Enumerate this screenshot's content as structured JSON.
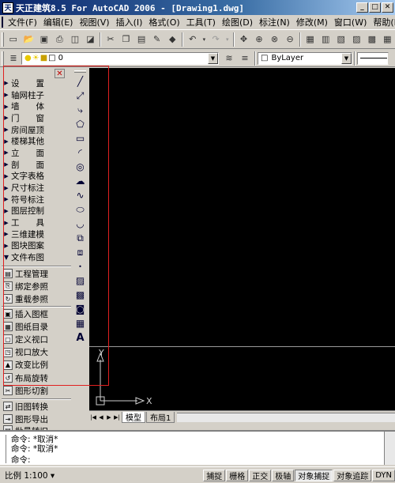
{
  "window": {
    "title": "天正建筑8.5 For AutoCAD 2006 - [Drawing1.dwg]",
    "app_icon_label": "天"
  },
  "menubar": {
    "items": [
      "文件(F)",
      "编辑(E)",
      "视图(V)",
      "插入(I)",
      "格式(O)",
      "工具(T)",
      "绘图(D)",
      "标注(N)",
      "修改(M)",
      "窗口(W)",
      "帮助(H)"
    ]
  },
  "layer_toolbar": {
    "layer_value": "0",
    "color_value": "ByLayer"
  },
  "tangent_menu": {
    "categories": [
      {
        "label": "设　　置",
        "open": false
      },
      {
        "label": "轴网柱子",
        "open": false
      },
      {
        "label": "墙　　体",
        "open": false
      },
      {
        "label": "门　　窗",
        "open": false
      },
      {
        "label": "房间屋顶",
        "open": false
      },
      {
        "label": "楼梯其他",
        "open": false
      },
      {
        "label": "立　　面",
        "open": false
      },
      {
        "label": "剖　　面",
        "open": false
      },
      {
        "label": "文字表格",
        "open": false
      },
      {
        "label": "尺寸标注",
        "open": false
      },
      {
        "label": "符号标注",
        "open": false
      },
      {
        "label": "图层控制",
        "open": false
      },
      {
        "label": "工　　具",
        "open": false
      },
      {
        "label": "三维建模",
        "open": false
      },
      {
        "label": "图块图案",
        "open": false
      },
      {
        "label": "文件布图",
        "open": true
      }
    ],
    "file_layout_items": [
      {
        "label": "工程管理",
        "icon": "project-icon"
      },
      {
        "label": "绑定参照",
        "icon": "bind-icon"
      },
      {
        "label": "重载参照",
        "icon": "reload-icon"
      },
      {
        "label": "插入图框",
        "icon": "frame-icon"
      },
      {
        "label": "图纸目录",
        "icon": "catalog-icon"
      },
      {
        "label": "定义视口",
        "icon": "viewport-icon"
      },
      {
        "label": "视口放大",
        "icon": "zoom-viewport-icon"
      },
      {
        "label": "改变比例",
        "icon": "scale-icon"
      },
      {
        "label": "布局旋转",
        "icon": "rotate-icon"
      },
      {
        "label": "图形切割",
        "icon": "cut-icon"
      },
      {
        "label": "旧图转换",
        "icon": "convert-icon"
      },
      {
        "label": "图形导出",
        "icon": "export-icon"
      },
      {
        "label": "批量转旧",
        "icon": "batch-icon"
      }
    ]
  },
  "canvas": {
    "ucs_y": "Y",
    "ucs_x": "X"
  },
  "layout_tabs": [
    "模型",
    "布局1"
  ],
  "command": {
    "lines": [
      "命令: *取消*",
      "命令: *取消*",
      "命令:"
    ]
  },
  "status": {
    "scale": "比例 1:100 ▾",
    "buttons": [
      {
        "label": "捕捉",
        "pressed": false
      },
      {
        "label": "栅格",
        "pressed": false
      },
      {
        "label": "正交",
        "pressed": false
      },
      {
        "label": "极轴",
        "pressed": false
      },
      {
        "label": "对象捕捉",
        "pressed": true
      },
      {
        "label": "对象追踪",
        "pressed": false
      },
      {
        "label": "DYN",
        "pressed": false
      }
    ]
  },
  "colors": {
    "titlebar_start": "#0a246a",
    "canvas_bg": "#000000",
    "annotation_red": "#e02020"
  }
}
